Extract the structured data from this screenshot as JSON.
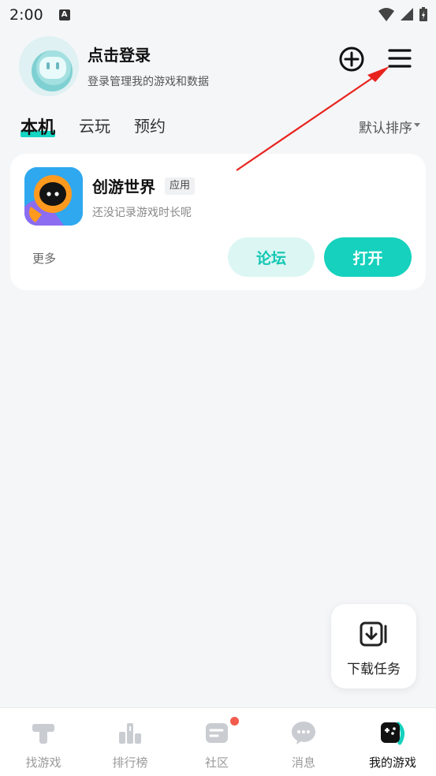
{
  "status_bar": {
    "time": "2:00",
    "notif_icon": "A"
  },
  "header": {
    "login_title": "点击登录",
    "login_subtitle": "登录管理我的游戏和数据"
  },
  "tabs": [
    {
      "label": "本机",
      "active": true
    },
    {
      "label": "云玩",
      "active": false
    },
    {
      "label": "预约",
      "active": false
    }
  ],
  "sort_label": "默认排序",
  "game": {
    "name": "创游世界",
    "tag": "应用",
    "playtime": "还没记录游戏时长呢",
    "more_label": "更多",
    "forum_label": "论坛",
    "open_label": "打开"
  },
  "download_task": {
    "label": "下载任务"
  },
  "bottom_nav": [
    {
      "label": "找游戏",
      "icon": "hammer-icon",
      "active": false
    },
    {
      "label": "排行榜",
      "icon": "ranking-icon",
      "active": false
    },
    {
      "label": "社区",
      "icon": "community-icon",
      "active": false,
      "badge": true
    },
    {
      "label": "消息",
      "icon": "message-icon",
      "active": false
    },
    {
      "label": "我的游戏",
      "icon": "gamepad-icon",
      "active": true
    }
  ],
  "colors": {
    "accent": "#15d1bd",
    "accent_light": "#dcf6f3",
    "badge": "#f25b4d",
    "annotation": "#e8231e"
  }
}
